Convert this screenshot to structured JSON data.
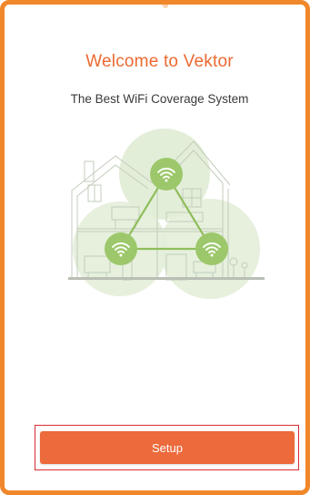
{
  "welcome": {
    "title": "Welcome to Vektor",
    "subtitle": "The Best WiFi Coverage System"
  },
  "illustration": {
    "icon": "mesh-wifi-house-illustration",
    "nodes": [
      "wifi-icon",
      "wifi-icon",
      "wifi-icon"
    ]
  },
  "actions": {
    "setup_label": "Setup"
  },
  "colors": {
    "accent": "#ec6a3b",
    "frame": "#f0872a",
    "highlight": "#d82d33",
    "coverage": "#dcebd2",
    "node": "#9cc86b"
  }
}
